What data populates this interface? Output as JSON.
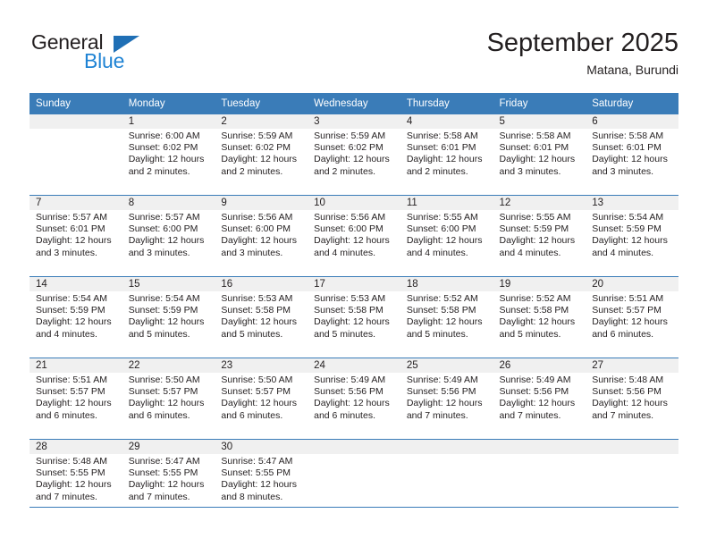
{
  "brand": {
    "name_part1": "General",
    "name_part2": "Blue",
    "accent_color": "#1f83d4",
    "triangle_color": "#1f6fb5"
  },
  "header": {
    "title": "September 2025",
    "subtitle": "Matana, Burundi"
  },
  "theme": {
    "header_row_color": "#3a7cb8",
    "daynum_band_color": "#f0f0f0",
    "text_color": "#231f20"
  },
  "weekday_headers": [
    "Sunday",
    "Monday",
    "Tuesday",
    "Wednesday",
    "Thursday",
    "Friday",
    "Saturday"
  ],
  "weeks": [
    [
      {
        "day": "",
        "sunrise": "",
        "sunset": "",
        "daylight_line1": "",
        "daylight_line2": "",
        "empty": true
      },
      {
        "day": "1",
        "sunrise": "Sunrise: 6:00 AM",
        "sunset": "Sunset: 6:02 PM",
        "daylight_line1": "Daylight: 12 hours",
        "daylight_line2": "and 2 minutes."
      },
      {
        "day": "2",
        "sunrise": "Sunrise: 5:59 AM",
        "sunset": "Sunset: 6:02 PM",
        "daylight_line1": "Daylight: 12 hours",
        "daylight_line2": "and 2 minutes."
      },
      {
        "day": "3",
        "sunrise": "Sunrise: 5:59 AM",
        "sunset": "Sunset: 6:02 PM",
        "daylight_line1": "Daylight: 12 hours",
        "daylight_line2": "and 2 minutes."
      },
      {
        "day": "4",
        "sunrise": "Sunrise: 5:58 AM",
        "sunset": "Sunset: 6:01 PM",
        "daylight_line1": "Daylight: 12 hours",
        "daylight_line2": "and 2 minutes."
      },
      {
        "day": "5",
        "sunrise": "Sunrise: 5:58 AM",
        "sunset": "Sunset: 6:01 PM",
        "daylight_line1": "Daylight: 12 hours",
        "daylight_line2": "and 3 minutes."
      },
      {
        "day": "6",
        "sunrise": "Sunrise: 5:58 AM",
        "sunset": "Sunset: 6:01 PM",
        "daylight_line1": "Daylight: 12 hours",
        "daylight_line2": "and 3 minutes."
      }
    ],
    [
      {
        "day": "7",
        "sunrise": "Sunrise: 5:57 AM",
        "sunset": "Sunset: 6:01 PM",
        "daylight_line1": "Daylight: 12 hours",
        "daylight_line2": "and 3 minutes."
      },
      {
        "day": "8",
        "sunrise": "Sunrise: 5:57 AM",
        "sunset": "Sunset: 6:00 PM",
        "daylight_line1": "Daylight: 12 hours",
        "daylight_line2": "and 3 minutes."
      },
      {
        "day": "9",
        "sunrise": "Sunrise: 5:56 AM",
        "sunset": "Sunset: 6:00 PM",
        "daylight_line1": "Daylight: 12 hours",
        "daylight_line2": "and 3 minutes."
      },
      {
        "day": "10",
        "sunrise": "Sunrise: 5:56 AM",
        "sunset": "Sunset: 6:00 PM",
        "daylight_line1": "Daylight: 12 hours",
        "daylight_line2": "and 4 minutes."
      },
      {
        "day": "11",
        "sunrise": "Sunrise: 5:55 AM",
        "sunset": "Sunset: 6:00 PM",
        "daylight_line1": "Daylight: 12 hours",
        "daylight_line2": "and 4 minutes."
      },
      {
        "day": "12",
        "sunrise": "Sunrise: 5:55 AM",
        "sunset": "Sunset: 5:59 PM",
        "daylight_line1": "Daylight: 12 hours",
        "daylight_line2": "and 4 minutes."
      },
      {
        "day": "13",
        "sunrise": "Sunrise: 5:54 AM",
        "sunset": "Sunset: 5:59 PM",
        "daylight_line1": "Daylight: 12 hours",
        "daylight_line2": "and 4 minutes."
      }
    ],
    [
      {
        "day": "14",
        "sunrise": "Sunrise: 5:54 AM",
        "sunset": "Sunset: 5:59 PM",
        "daylight_line1": "Daylight: 12 hours",
        "daylight_line2": "and 4 minutes."
      },
      {
        "day": "15",
        "sunrise": "Sunrise: 5:54 AM",
        "sunset": "Sunset: 5:59 PM",
        "daylight_line1": "Daylight: 12 hours",
        "daylight_line2": "and 5 minutes."
      },
      {
        "day": "16",
        "sunrise": "Sunrise: 5:53 AM",
        "sunset": "Sunset: 5:58 PM",
        "daylight_line1": "Daylight: 12 hours",
        "daylight_line2": "and 5 minutes."
      },
      {
        "day": "17",
        "sunrise": "Sunrise: 5:53 AM",
        "sunset": "Sunset: 5:58 PM",
        "daylight_line1": "Daylight: 12 hours",
        "daylight_line2": "and 5 minutes."
      },
      {
        "day": "18",
        "sunrise": "Sunrise: 5:52 AM",
        "sunset": "Sunset: 5:58 PM",
        "daylight_line1": "Daylight: 12 hours",
        "daylight_line2": "and 5 minutes."
      },
      {
        "day": "19",
        "sunrise": "Sunrise: 5:52 AM",
        "sunset": "Sunset: 5:58 PM",
        "daylight_line1": "Daylight: 12 hours",
        "daylight_line2": "and 5 minutes."
      },
      {
        "day": "20",
        "sunrise": "Sunrise: 5:51 AM",
        "sunset": "Sunset: 5:57 PM",
        "daylight_line1": "Daylight: 12 hours",
        "daylight_line2": "and 6 minutes."
      }
    ],
    [
      {
        "day": "21",
        "sunrise": "Sunrise: 5:51 AM",
        "sunset": "Sunset: 5:57 PM",
        "daylight_line1": "Daylight: 12 hours",
        "daylight_line2": "and 6 minutes."
      },
      {
        "day": "22",
        "sunrise": "Sunrise: 5:50 AM",
        "sunset": "Sunset: 5:57 PM",
        "daylight_line1": "Daylight: 12 hours",
        "daylight_line2": "and 6 minutes."
      },
      {
        "day": "23",
        "sunrise": "Sunrise: 5:50 AM",
        "sunset": "Sunset: 5:57 PM",
        "daylight_line1": "Daylight: 12 hours",
        "daylight_line2": "and 6 minutes."
      },
      {
        "day": "24",
        "sunrise": "Sunrise: 5:49 AM",
        "sunset": "Sunset: 5:56 PM",
        "daylight_line1": "Daylight: 12 hours",
        "daylight_line2": "and 6 minutes."
      },
      {
        "day": "25",
        "sunrise": "Sunrise: 5:49 AM",
        "sunset": "Sunset: 5:56 PM",
        "daylight_line1": "Daylight: 12 hours",
        "daylight_line2": "and 7 minutes."
      },
      {
        "day": "26",
        "sunrise": "Sunrise: 5:49 AM",
        "sunset": "Sunset: 5:56 PM",
        "daylight_line1": "Daylight: 12 hours",
        "daylight_line2": "and 7 minutes."
      },
      {
        "day": "27",
        "sunrise": "Sunrise: 5:48 AM",
        "sunset": "Sunset: 5:56 PM",
        "daylight_line1": "Daylight: 12 hours",
        "daylight_line2": "and 7 minutes."
      }
    ],
    [
      {
        "day": "28",
        "sunrise": "Sunrise: 5:48 AM",
        "sunset": "Sunset: 5:55 PM",
        "daylight_line1": "Daylight: 12 hours",
        "daylight_line2": "and 7 minutes."
      },
      {
        "day": "29",
        "sunrise": "Sunrise: 5:47 AM",
        "sunset": "Sunset: 5:55 PM",
        "daylight_line1": "Daylight: 12 hours",
        "daylight_line2": "and 7 minutes."
      },
      {
        "day": "30",
        "sunrise": "Sunrise: 5:47 AM",
        "sunset": "Sunset: 5:55 PM",
        "daylight_line1": "Daylight: 12 hours",
        "daylight_line2": "and 8 minutes."
      },
      {
        "day": "",
        "sunrise": "",
        "sunset": "",
        "daylight_line1": "",
        "daylight_line2": "",
        "empty": true
      },
      {
        "day": "",
        "sunrise": "",
        "sunset": "",
        "daylight_line1": "",
        "daylight_line2": "",
        "empty": true
      },
      {
        "day": "",
        "sunrise": "",
        "sunset": "",
        "daylight_line1": "",
        "daylight_line2": "",
        "empty": true
      },
      {
        "day": "",
        "sunrise": "",
        "sunset": "",
        "daylight_line1": "",
        "daylight_line2": "",
        "empty": true
      }
    ]
  ]
}
